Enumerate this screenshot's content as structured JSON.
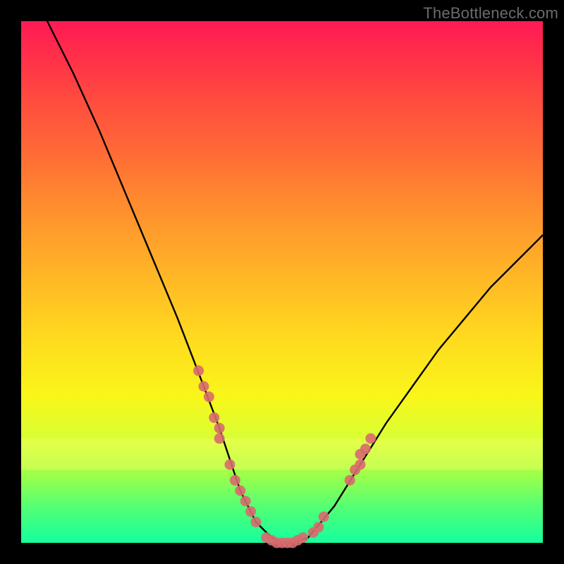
{
  "watermark": "TheBottleneck.com",
  "chart_data": {
    "type": "line",
    "title": "",
    "xlabel": "",
    "ylabel": "",
    "xlim": [
      0,
      100
    ],
    "ylim": [
      0,
      100
    ],
    "curve": {
      "name": "bottleneck-curve",
      "x": [
        5,
        10,
        15,
        20,
        25,
        30,
        35,
        38,
        40,
        42,
        45,
        48,
        50,
        52,
        55,
        60,
        65,
        70,
        75,
        80,
        85,
        90,
        95,
        100
      ],
      "y": [
        100,
        90,
        79,
        67,
        55,
        43,
        30,
        22,
        16,
        10,
        4,
        1,
        0,
        0,
        1,
        7,
        15,
        23,
        30,
        37,
        43,
        49,
        54,
        59
      ]
    },
    "marker_clusters": [
      {
        "name": "left-upper",
        "color": "#d86a6e",
        "points": [
          {
            "x": 34,
            "y": 33
          },
          {
            "x": 35,
            "y": 30
          },
          {
            "x": 36,
            "y": 28
          },
          {
            "x": 37,
            "y": 24
          },
          {
            "x": 38,
            "y": 22
          },
          {
            "x": 38,
            "y": 20
          }
        ]
      },
      {
        "name": "left-lower",
        "color": "#d86a6e",
        "points": [
          {
            "x": 40,
            "y": 15
          },
          {
            "x": 41,
            "y": 12
          },
          {
            "x": 42,
            "y": 10
          },
          {
            "x": 43,
            "y": 8
          },
          {
            "x": 44,
            "y": 6
          },
          {
            "x": 45,
            "y": 4
          }
        ]
      },
      {
        "name": "valley",
        "color": "#d86a6e",
        "points": [
          {
            "x": 47,
            "y": 1
          },
          {
            "x": 48,
            "y": 0.5
          },
          {
            "x": 49,
            "y": 0
          },
          {
            "x": 50,
            "y": 0
          },
          {
            "x": 51,
            "y": 0
          },
          {
            "x": 52,
            "y": 0
          },
          {
            "x": 53,
            "y": 0.5
          },
          {
            "x": 54,
            "y": 1
          },
          {
            "x": 56,
            "y": 2
          },
          {
            "x": 57,
            "y": 3
          },
          {
            "x": 58,
            "y": 5
          }
        ]
      },
      {
        "name": "right-upper",
        "color": "#d86a6e",
        "points": [
          {
            "x": 63,
            "y": 12
          },
          {
            "x": 64,
            "y": 14
          },
          {
            "x": 65,
            "y": 15
          },
          {
            "x": 65,
            "y": 17
          },
          {
            "x": 66,
            "y": 18
          },
          {
            "x": 67,
            "y": 20
          }
        ]
      }
    ],
    "yellow_band": {
      "y_range": [
        14,
        20
      ],
      "color": "#ffff6a",
      "opacity": 0.35
    }
  }
}
